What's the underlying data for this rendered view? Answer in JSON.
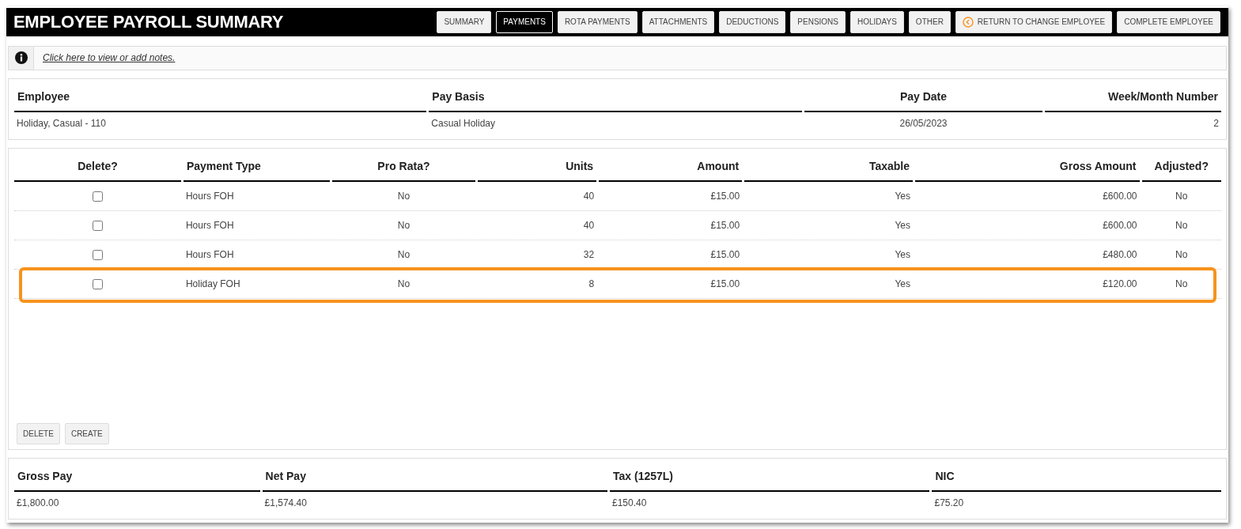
{
  "header": {
    "title": "EMPLOYEE PAYROLL SUMMARY",
    "buttons": [
      {
        "label": "SUMMARY",
        "selected": false,
        "kind": "tab"
      },
      {
        "label": "PAYMENTS",
        "selected": true,
        "kind": "tab"
      },
      {
        "label": "ROTA PAYMENTS",
        "selected": false,
        "kind": "tab"
      },
      {
        "label": "ATTACHMENTS",
        "selected": false,
        "kind": "tab"
      },
      {
        "label": "DEDUCTIONS",
        "selected": false,
        "kind": "tab"
      },
      {
        "label": "PENSIONS",
        "selected": false,
        "kind": "tab"
      },
      {
        "label": "HOLIDAYS",
        "selected": false,
        "kind": "tab"
      },
      {
        "label": "OTHER",
        "selected": false,
        "kind": "tab"
      },
      {
        "label": "RETURN TO CHANGE EMPLOYEE",
        "selected": false,
        "kind": "back"
      },
      {
        "label": "COMPLETE EMPLOYEE",
        "selected": false,
        "kind": "tab"
      }
    ]
  },
  "notes": {
    "link": "Click here to view or add notes."
  },
  "employee_info": {
    "columns": [
      "Employee",
      "Pay Basis",
      "Pay Date",
      "Week/Month Number"
    ],
    "values": [
      "Holiday, Casual - 110",
      "Casual Holiday",
      "26/05/2023",
      "2"
    ]
  },
  "payments": {
    "columns": [
      "Delete?",
      "Payment Type",
      "Pro Rata?",
      "Units",
      "Amount",
      "Taxable",
      "Gross Amount",
      "Adjusted?"
    ],
    "rows": [
      {
        "checked": false,
        "highlighted": false,
        "payment_type": "Hours FOH",
        "pro_rata": "No",
        "units": "40",
        "amount": "£15.00",
        "taxable": "Yes",
        "gross_amount": "£600.00",
        "adjusted": "No"
      },
      {
        "checked": false,
        "highlighted": false,
        "payment_type": "Hours FOH",
        "pro_rata": "No",
        "units": "40",
        "amount": "£15.00",
        "taxable": "Yes",
        "gross_amount": "£600.00",
        "adjusted": "No"
      },
      {
        "checked": false,
        "highlighted": false,
        "payment_type": "Hours FOH",
        "pro_rata": "No",
        "units": "32",
        "amount": "£15.00",
        "taxable": "Yes",
        "gross_amount": "£480.00",
        "adjusted": "No"
      },
      {
        "checked": false,
        "highlighted": true,
        "payment_type": "Holiday FOH",
        "pro_rata": "No",
        "units": "8",
        "amount": "£15.00",
        "taxable": "Yes",
        "gross_amount": "£120.00",
        "adjusted": "No"
      }
    ],
    "buttons": [
      "DELETE",
      "CREATE"
    ]
  },
  "totals": {
    "columns": [
      "Gross Pay",
      "Net Pay",
      "Tax (1257L)",
      "NIC"
    ],
    "values": [
      "£1,800.00",
      "£1,574.40",
      "£150.40",
      "£75.20"
    ]
  }
}
